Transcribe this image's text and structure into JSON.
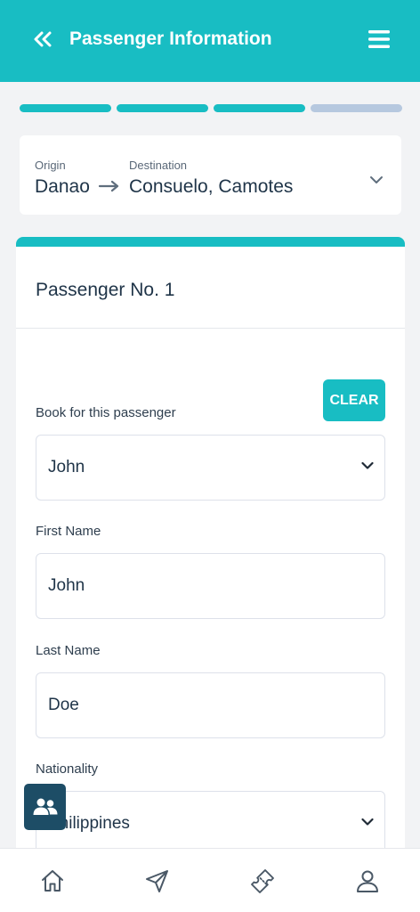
{
  "header": {
    "title": "Passenger Information",
    "back_icon": "double-chevron-left-icon",
    "menu_icon": "hamburger-menu-icon"
  },
  "progress": {
    "total_steps": 4,
    "completed_steps": 3
  },
  "route": {
    "origin_label": "Origin",
    "origin_value": "Danao",
    "destination_label": "Destination",
    "destination_value": "Consuelo, Camotes",
    "arrow_icon": "arrow-right-icon",
    "expand_icon": "chevron-down-icon"
  },
  "passenger": {
    "title": "Passenger No. 1",
    "clear_label": "CLEAR",
    "book_for_label": "Book for this passenger",
    "book_for_value": "John",
    "first_name_label": "First Name",
    "first_name_value": "John",
    "last_name_label": "Last Name",
    "last_name_value": "Doe",
    "nationality_label": "Nationality",
    "nationality_value": "Philippines"
  },
  "fab": {
    "icon": "users-icon"
  },
  "bottom_nav": {
    "items": [
      "home-icon",
      "send-icon",
      "ticket-icon",
      "user-icon"
    ]
  },
  "colors": {
    "accent": "#18bdc3",
    "dark": "#1d4d66",
    "text": "#1f3448",
    "progress_pending": "#b6c8df"
  }
}
